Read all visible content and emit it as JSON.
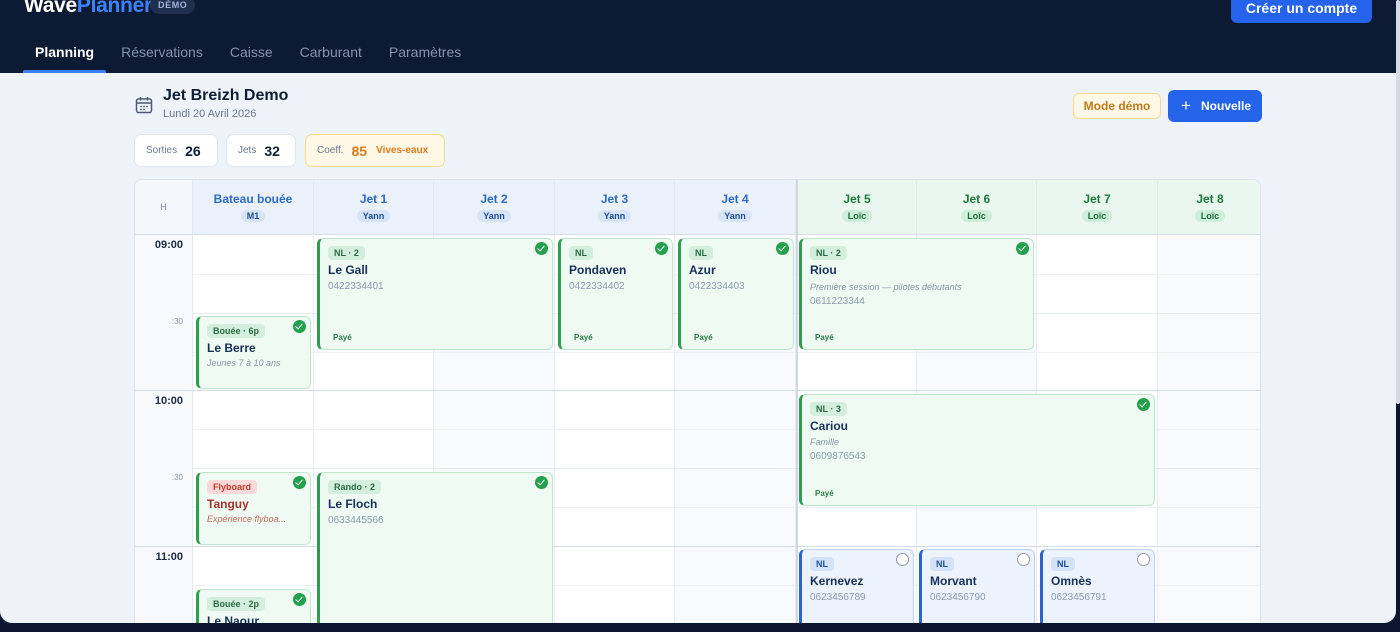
{
  "header": {
    "logo_part1": "Wave",
    "logo_part2": "Planner",
    "badge": "DÉMO",
    "create_account": "Créer un compte"
  },
  "nav": {
    "tabs": [
      "Planning",
      "Réservations",
      "Caisse",
      "Carburant",
      "Paramètres"
    ],
    "active": "Planning"
  },
  "page": {
    "title": "Jet Breizh Demo",
    "date": "Lundi 20 Avril 2026",
    "mode_demo": "Mode démo",
    "new_button": "Nouvelle",
    "new_icon": "plus-icon",
    "calendar_icon": "calendar-icon"
  },
  "stats": {
    "sorties_label": "Sorties",
    "sorties_value": "26",
    "jets_label": "Jets",
    "jets_value": "32",
    "coef_label": "Coeff.",
    "coef_value": "85",
    "coef_extra": "Vives-eaux"
  },
  "grid": {
    "hour_header": "H",
    "columns": [
      {
        "name": "Bateau bouée",
        "who": "M1",
        "group": "blue"
      },
      {
        "name": "Jet 1",
        "who": "Yann",
        "group": "blue"
      },
      {
        "name": "Jet 2",
        "who": "Yann",
        "group": "blue"
      },
      {
        "name": "Jet 3",
        "who": "Yann",
        "group": "blue"
      },
      {
        "name": "Jet 4",
        "who": "Yann",
        "group": "blue"
      },
      {
        "name": "Jet 5",
        "who": "Loïc",
        "group": "green"
      },
      {
        "name": "Jet 6",
        "who": "Loïc",
        "group": "green"
      },
      {
        "name": "Jet 7",
        "who": "Loïc",
        "group": "green"
      },
      {
        "name": "Jet 8",
        "who": "Loïc",
        "group": "green"
      }
    ],
    "times": [
      "09:00",
      ":30",
      "10:00",
      ":30",
      "11:00"
    ]
  },
  "reservations": {
    "legall": {
      "tag": "NL · 2",
      "name": "Le Gall",
      "phone": "0422334401",
      "status": "Payé"
    },
    "pondaven": {
      "tag": "NL",
      "name": "Pondaven",
      "phone": "0422334402",
      "status": "Payé"
    },
    "azur": {
      "tag": "NL",
      "name": "Azur",
      "phone": "0422334403",
      "status": "Payé"
    },
    "riou": {
      "tag": "NL · 2",
      "name": "Riou",
      "note": "Première session — pilotes débutants",
      "phone": "0611223344",
      "status": "Payé"
    },
    "leberre": {
      "tag": "Bouée · 6p",
      "name": "Le Berre",
      "note": "Jeunes 7 à 10 ans"
    },
    "cariou": {
      "tag": "NL · 3",
      "name": "Cariou",
      "note": "Famille",
      "phone": "0609876543",
      "status": "Payé"
    },
    "tanguy": {
      "tag": "Flyboard",
      "name": "Tanguy",
      "note": "Expérience flyboa..."
    },
    "lefloch": {
      "tag": "Rando · 2",
      "name": "Le Floch",
      "phone": "0633445566"
    },
    "kernevez": {
      "tag": "NL",
      "name": "Kernevez",
      "phone": "0623456789"
    },
    "morvant": {
      "tag": "NL",
      "name": "Morvant",
      "phone": "0623456790"
    },
    "omnes": {
      "tag": "NL",
      "name": "Omnès",
      "phone": "0623456791"
    },
    "lenaour": {
      "tag": "Bouée · 2p",
      "name": "Le Naour"
    }
  },
  "colors": {
    "accent": "#2563eb",
    "header_bg": "#0d1a34",
    "paid_green": "#2f9c4f",
    "pending_blue": "#2a63c9",
    "flyboard_red": "#c0392b"
  }
}
